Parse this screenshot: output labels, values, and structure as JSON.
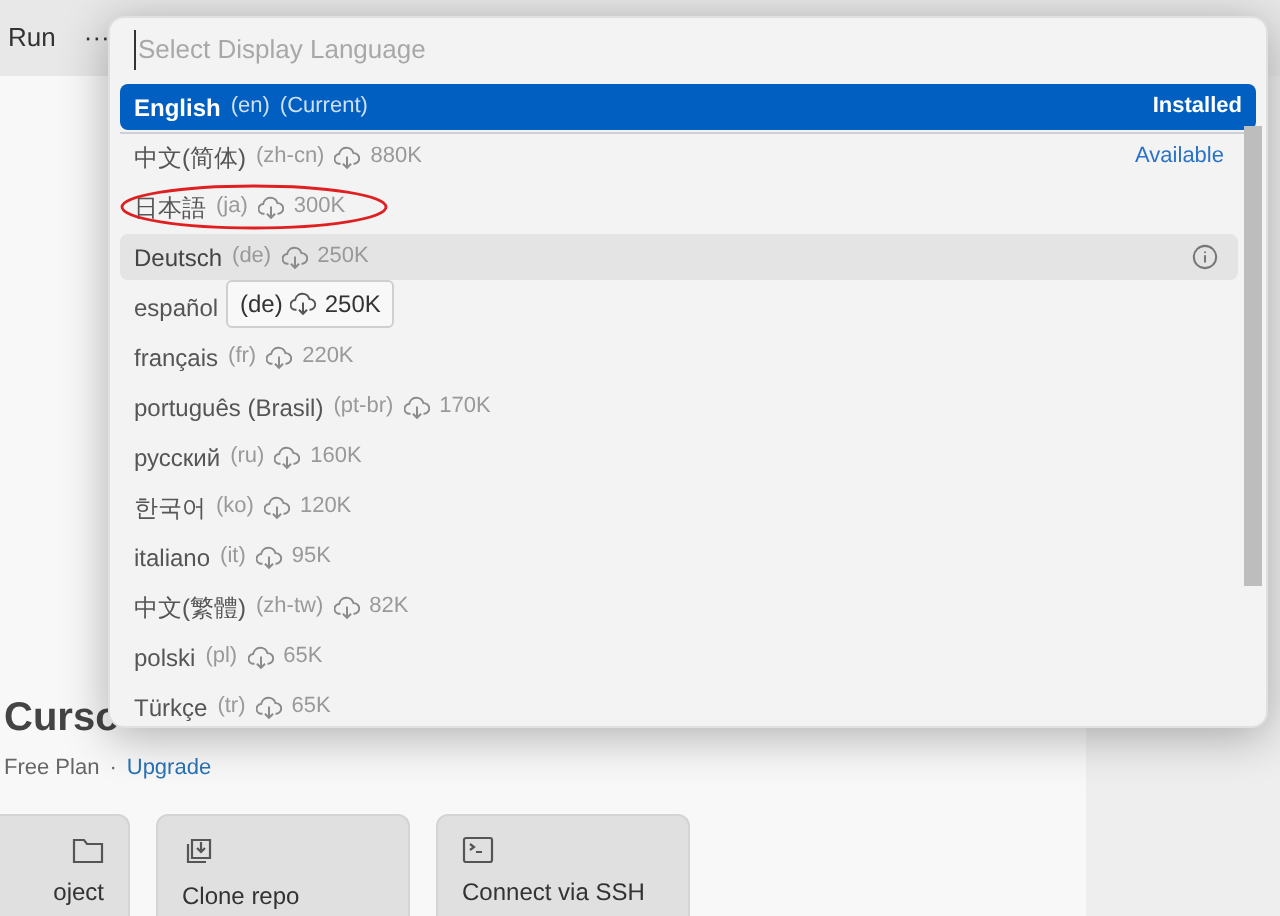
{
  "menubar": {
    "items": [
      "Run",
      "···"
    ]
  },
  "welcome": {
    "title": "Curso",
    "plan": "Free Plan",
    "separator": "·",
    "upgrade_link": "Upgrade",
    "cards": [
      {
        "label": "oject",
        "kind": "folder"
      },
      {
        "label": "Clone repo",
        "kind": "clone"
      },
      {
        "label": "Connect via SSH",
        "kind": "terminal"
      }
    ]
  },
  "language_picker": {
    "placeholder": "Select Display Language",
    "items": [
      {
        "name": "English",
        "code": "(en)",
        "note": "(Current)",
        "status": "Installed",
        "selected": true,
        "hovered": false,
        "circled": false
      },
      {
        "name": "中文(简体)",
        "code": "(zh-cn)",
        "size": "880K",
        "status": "Available",
        "selected": false,
        "hovered": false,
        "circled": false
      },
      {
        "name": "日本語",
        "code": "(ja)",
        "size": "300K",
        "selected": false,
        "hovered": false,
        "circled": true
      },
      {
        "name": "Deutsch",
        "code": "(de)",
        "size": "250K",
        "selected": false,
        "hovered": true,
        "circled": false
      },
      {
        "name": "español",
        "selected": false,
        "hovered": false,
        "circled": false
      },
      {
        "name": "français",
        "code": "(fr)",
        "size": "220K",
        "selected": false,
        "hovered": false,
        "circled": false
      },
      {
        "name": "português (Brasil)",
        "code": "(pt-br)",
        "size": "170K",
        "selected": false,
        "hovered": false,
        "circled": false
      },
      {
        "name": "русский",
        "code": "(ru)",
        "size": "160K",
        "selected": false,
        "hovered": false,
        "circled": false
      },
      {
        "name": "한국어",
        "code": "(ko)",
        "size": "120K",
        "selected": false,
        "hovered": false,
        "circled": false
      },
      {
        "name": "italiano",
        "code": "(it)",
        "size": "95K",
        "selected": false,
        "hovered": false,
        "circled": false
      },
      {
        "name": "中文(繁體)",
        "code": "(zh-tw)",
        "size": "82K",
        "selected": false,
        "hovered": false,
        "circled": false
      },
      {
        "name": "polski",
        "code": "(pl)",
        "size": "65K",
        "selected": false,
        "hovered": false,
        "circled": false
      },
      {
        "name": "Türkçe",
        "code": "(tr)",
        "size": "65K",
        "selected": false,
        "hovered": false,
        "circled": false
      }
    ],
    "tooltip": {
      "code": "(de)",
      "size": "250K"
    }
  }
}
